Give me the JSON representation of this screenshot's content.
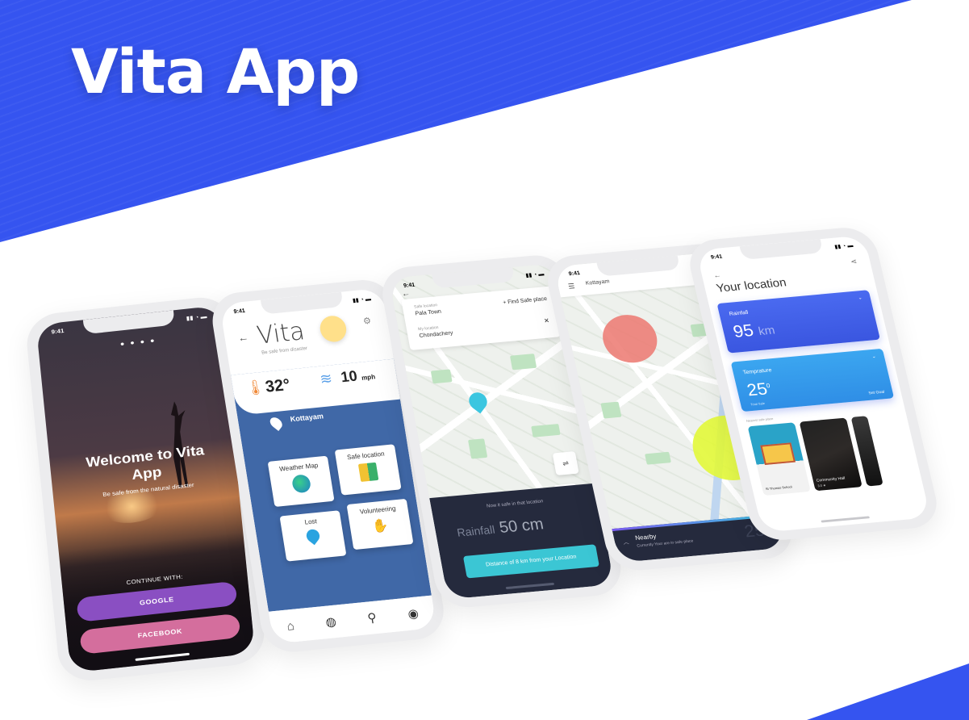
{
  "header": {
    "title": "Vita App"
  },
  "colors": {
    "brand_blue": "#3554f0",
    "accent_cyan": "#3bc6d4",
    "google_purple": "#8a4fc2",
    "facebook_pink": "#d46e9d",
    "dark_panel": "#252a3d"
  },
  "phone1": {
    "time": "9:41",
    "dots": "● ● ● ●",
    "welcome": "Welcome to Vita App",
    "subtitle": "Be safe from the natural disaster",
    "continue_with": "CONTINUE WITH:",
    "google": "GOOGLE",
    "facebook": "FACEBOOK"
  },
  "phone2": {
    "time": "9:41",
    "app_name": "Vita",
    "tagline": "Be safe from disaster",
    "temperature": "32°",
    "wind_speed": "10",
    "wind_unit": "mph",
    "location": "Kottayam",
    "cards": [
      "Weather Map",
      "Safe location",
      "Lost",
      "Volunteering"
    ],
    "nav_icons": [
      "home-icon",
      "globe-icon",
      "search-icon",
      "profile-icon"
    ]
  },
  "phone3": {
    "time": "9:41",
    "safe_label": "Safe location",
    "safe_value": "Pala Town",
    "my_label": "My location",
    "my_value": "Chondachery",
    "find": "+ Find Safe place",
    "now_text": "Now it safe in that location",
    "rain_label": "Rainfall",
    "rain_value": "50 cm",
    "distance": "Distance of 8 km from your Location"
  },
  "phone4": {
    "time": "9:41",
    "location": "Kottayam",
    "nearby": "Nearby",
    "nearby_sub": "Currently Your are in safe place",
    "temp": "25°"
  },
  "phone5": {
    "time": "9:41",
    "title": "Your location",
    "rain_label": "Rainfall",
    "rain_value": "95",
    "rain_unit": "km",
    "temp_label": "Temprature",
    "temp_value": "25",
    "temp_unit": "0",
    "total": "Total Sale",
    "set_goal": "Set Goal",
    "nearest": "Nearest safe place",
    "place1": "St Thomas School",
    "place2": "Community Hall",
    "place2_sub": "3.0 ★"
  }
}
